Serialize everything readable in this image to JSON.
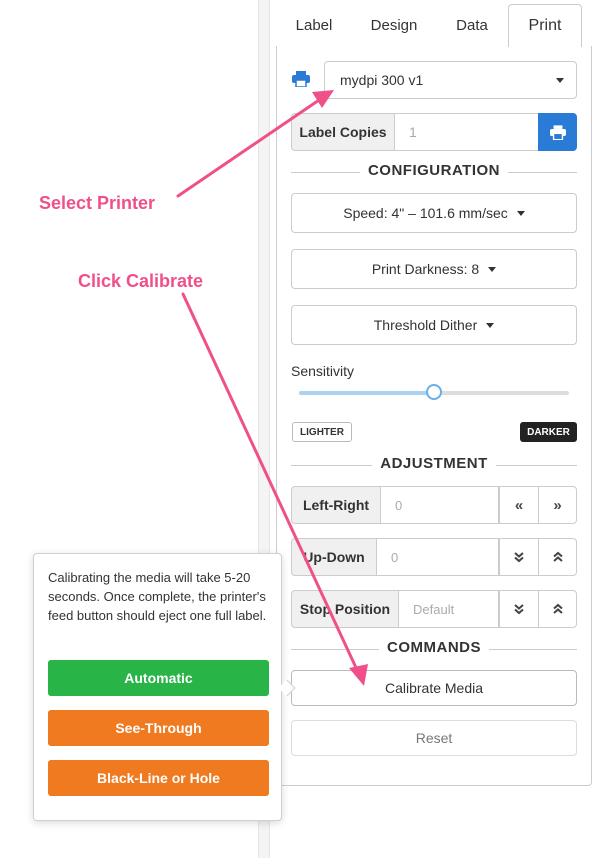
{
  "tabs": [
    {
      "label": "Label"
    },
    {
      "label": "Design"
    },
    {
      "label": "Data"
    },
    {
      "label": "Print",
      "active": true
    }
  ],
  "printer": {
    "icon": "printer-icon",
    "selected": "mydpi 300 v1"
  },
  "copies": {
    "label": "Label Copies",
    "placeholder": "1",
    "print_icon": "printer-icon"
  },
  "configuration": {
    "heading": "CONFIGURATION",
    "speed": "Speed: 4\" – 101.6 mm/sec",
    "darkness": "Print Darkness: 8",
    "dither": "Threshold Dither",
    "sensitivity_label": "Sensitivity",
    "sensitivity_value": 0.5,
    "lighter": "LIGHTER",
    "darker": "DARKER"
  },
  "adjustment": {
    "heading": "ADJUSTMENT",
    "left_right": {
      "label": "Left-Right",
      "placeholder": "0"
    },
    "up_down": {
      "label": "Up-Down",
      "placeholder": "0"
    },
    "stop_position": {
      "label": "Stop Position",
      "placeholder": "Default"
    }
  },
  "commands": {
    "heading": "COMMANDS",
    "calibrate": "Calibrate Media",
    "reset": "Reset"
  },
  "popover": {
    "text": "Calibrating the media will take 5-20 seconds. Once complete, the printer's feed button should eject one full label.",
    "automatic": "Automatic",
    "see_through": "See-Through",
    "black_line": "Black-Line or Hole"
  },
  "annotations": {
    "select_printer": "Select Printer",
    "click_calibrate": "Click Calibrate",
    "color": "#f0508a"
  },
  "colors": {
    "primary": "#2a7bd5",
    "green": "#28b446",
    "orange": "#f07a1f"
  }
}
